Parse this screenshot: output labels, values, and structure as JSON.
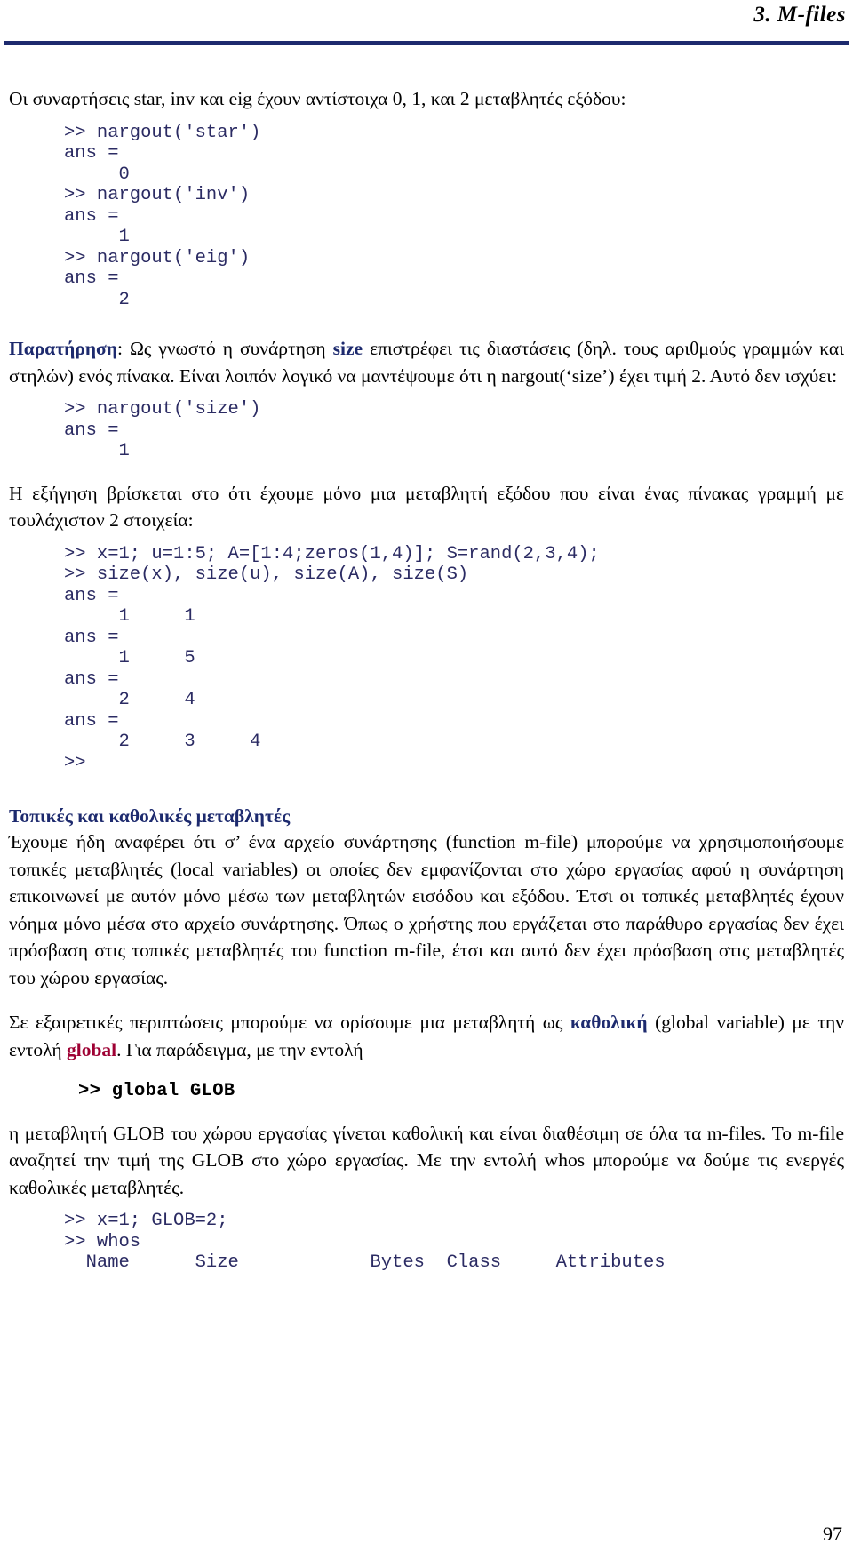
{
  "header": {
    "title": "3.  M-files",
    "rule_color": "#1d2a6e"
  },
  "colors": {
    "accent_navy": "#1d2a6e",
    "accent_red": "#9e0033",
    "code_navy": "#2b2b63",
    "body_black": "#000000"
  },
  "intro": {
    "paragraph": "Οι συναρτήσεις star, inv και eig έχουν αντίστοιχα 0, 1, και 2 μεταβλητές εξόδου:"
  },
  "code_blocks": {
    "nargout_star_inv_eig": ">> nargout('star')\nans =\n     0\n>> nargout('inv')\nans =\n     1\n>> nargout('eig')\nans =\n     2",
    "nargout_size": ">> nargout('size')\nans =\n     1",
    "size_demo": ">> x=1; u=1:5; A=[1:4;zeros(1,4)]; S=rand(2,3,4);\n>> size(x), size(u), size(A), size(S)\nans =\n     1     1\nans =\n     1     5\nans =\n     2     4\nans =\n     2     3     4\n>>",
    "global_decl": ">> global GLOB",
    "whos_demo": ">> x=1; GLOB=2;\n>> whos\n  Name      Size            Bytes  Class     Attributes"
  },
  "note": {
    "label": "Παρατήρηση",
    "label_sep": ": ",
    "part1": "Ως γνωστό η συνάρτηση ",
    "keyword": "size",
    "part2": " επιστρέφει τις διαστάσεις (δηλ. τους αριθμούς γραμμών και στηλών) ενός πίνακα. Είναι λοιπόν λογικό να μαντέψουμε ότι η nargout(‘size’) έχει τιμή 2. Αυτό δεν ισχύει:"
  },
  "explanation": {
    "paragraph": "Η εξήγηση βρίσκεται στο ότι έχουμε μόνο μια μεταβλητή εξόδου που είναι ένας πίνακας γραμμή με τουλάχιστον 2 στοιχεία:"
  },
  "section_local_global": {
    "heading": "Τοπικές και καθολικές μεταβλητές",
    "paragraph1": "Έχουμε ήδη αναφέρει ότι σ’ ένα αρχείο συνάρτησης (function m-file) μπορούμε να χρησιμοποιήσουμε τοπικές μεταβλητές (local variables) οι οποίες δεν εμφανίζονται στο χώρο εργασίας αφού η συνάρτηση επικοινωνεί με αυτόν μόνο μέσω των μεταβλητών εισόδου και εξόδου. Έτσι οι τοπικές μεταβλητές έχουν νόημα μόνο μέσα στο αρχείο συνάρτησης. Όπως ο χρήστης που εργάζεται στο παράθυρο εργασίας δεν έχει πρόσβαση στις τοπικές μεταβλητές του function m-file, έτσι και αυτό δεν έχει πρόσβαση στις μεταβλητές του χώρου εργασίας.",
    "global_intro_part1": "Σε εξαιρετικές περιπτώσεις μπορούμε να ορίσουμε μια μεταβλητή ως ",
    "global_intro_bold_navy": "καθολική",
    "global_intro_part2": " (global variable) με την εντολή ",
    "global_keyword": "global",
    "global_intro_part3": ". Για παράδειγμα, με την εντολή",
    "after_global_paragraph": "η μεταβλητή GLOB του χώρου εργασίας γίνεται καθολική και είναι διαθέσιμη σε όλα τα m-files. Το m-file αναζητεί την τιμή της GLOB στο χώρο εργασίας. Με την εντολή whos μπορούμε να δούμε τις ενεργές καθολικές μεταβλητές."
  },
  "footer": {
    "page_number": "97"
  }
}
